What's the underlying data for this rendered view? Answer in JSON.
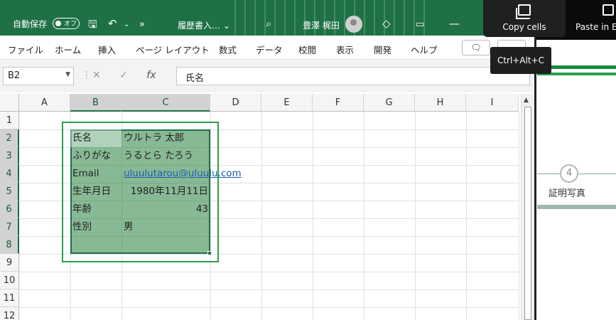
{
  "titlebar": {
    "autosave_label": "自動保存",
    "autosave_state": "オフ",
    "document_title": "履歴書入… ⌄",
    "user_name": "豊澤 梶田"
  },
  "ribbon": {
    "tabs": [
      "ファイル",
      "ホーム",
      "挿入",
      "ページ レイアウト",
      "数式",
      "データ",
      "校閲",
      "表示",
      "開発",
      "ヘルプ"
    ]
  },
  "formula_bar": {
    "name_box": "B2",
    "cancel": "✕",
    "enter": "✓",
    "fx": "fx",
    "formula": "氏名"
  },
  "sheet": {
    "columns": [
      "A",
      "B",
      "C",
      "D",
      "E",
      "F",
      "G",
      "H",
      "I"
    ],
    "rows": [
      "1",
      "2",
      "3",
      "4",
      "5",
      "6",
      "7",
      "8",
      "9",
      "10",
      "11",
      "12"
    ],
    "cells": {
      "B2": "氏名",
      "C2": "ウルトラ 太郎",
      "B3": "ふりがな",
      "C3": "うるとら たろう",
      "B4": "Email",
      "C4": "uluulutarou@uluulu.com",
      "B5": "生年月日",
      "C5": "1980年11月11日",
      "B6": "年齢",
      "C6": "43",
      "B7": "性別",
      "C7": "男"
    }
  },
  "toolbar_popup": {
    "copy_label": "Copy cells",
    "paste_label": "Paste in Ex",
    "tooltip": "Ctrl+Alt+C"
  },
  "side_panel": {
    "step_number": "4",
    "step_label": "証明写真"
  }
}
